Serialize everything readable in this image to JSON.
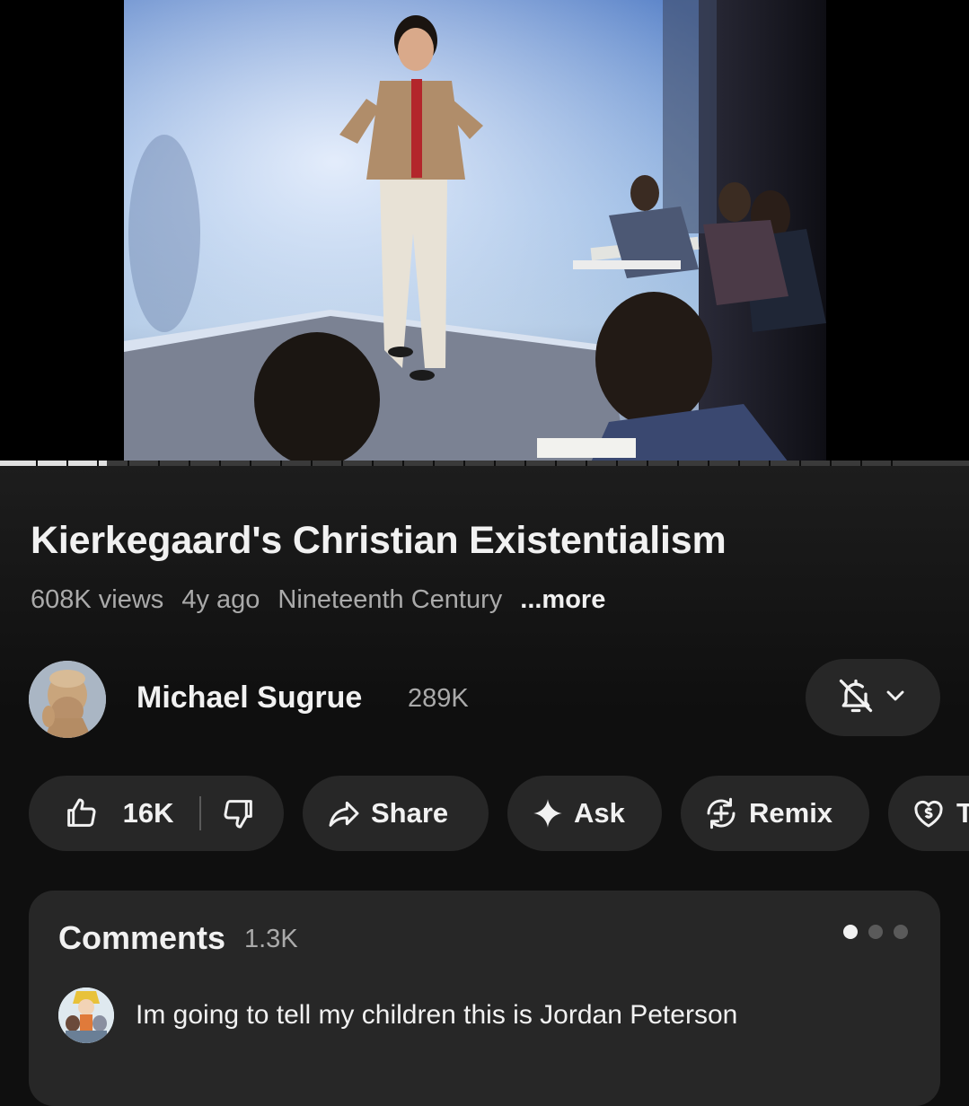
{
  "video": {
    "progress_fraction": 0.11
  },
  "title": "Kierkegaard's Christian Existentialism",
  "meta": {
    "views": "608K views",
    "age": "4y ago",
    "category": "Nineteenth Century",
    "more": "...more"
  },
  "channel": {
    "name": "Michael Sugrue",
    "subscribers": "289K"
  },
  "actions": {
    "like_count": "16K",
    "share": "Share",
    "ask": "Ask",
    "remix": "Remix",
    "thanks_partial": "T"
  },
  "comments": {
    "heading": "Comments",
    "count": "1.3K",
    "top_comment": "Im going to tell my children this is Jordan Peterson"
  },
  "icons": {
    "like": "thumbs-up-icon",
    "dislike": "thumbs-down-icon",
    "share": "share-arrow-icon",
    "ask": "sparkle-icon",
    "remix": "remix-icon",
    "thanks": "heart-dollar-icon",
    "bell": "bell-off-icon",
    "chevron": "chevron-down-icon"
  }
}
